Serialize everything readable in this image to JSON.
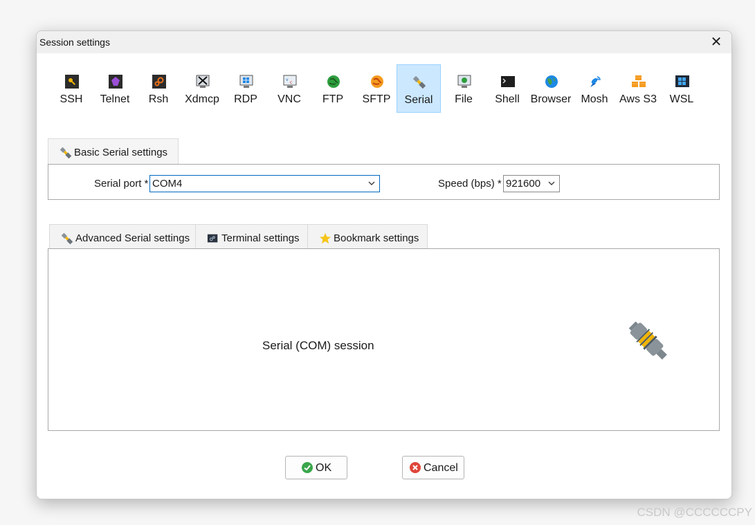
{
  "dialog": {
    "title": "Session settings",
    "close_label": "✕"
  },
  "toolbar": {
    "items": [
      {
        "label": "SSH",
        "icon": "ssh-icon"
      },
      {
        "label": "Telnet",
        "icon": "telnet-icon"
      },
      {
        "label": "Rsh",
        "icon": "rsh-icon"
      },
      {
        "label": "Xdmcp",
        "icon": "xdmcp-icon"
      },
      {
        "label": "RDP",
        "icon": "rdp-icon"
      },
      {
        "label": "VNC",
        "icon": "vnc-icon"
      },
      {
        "label": "FTP",
        "icon": "ftp-icon"
      },
      {
        "label": "SFTP",
        "icon": "sftp-icon"
      },
      {
        "label": "Serial",
        "icon": "serial-icon",
        "selected": true
      },
      {
        "label": "File",
        "icon": "file-icon"
      },
      {
        "label": "Shell",
        "icon": "shell-icon"
      },
      {
        "label": "Browser",
        "icon": "browser-icon"
      },
      {
        "label": "Mosh",
        "icon": "mosh-icon"
      },
      {
        "label": "Aws S3",
        "icon": "aws-s3-icon"
      },
      {
        "label": "WSL",
        "icon": "wsl-icon"
      }
    ]
  },
  "basic": {
    "tab_label": "Basic Serial settings",
    "serial_port_label": "Serial port *",
    "serial_port_value": "COM4",
    "speed_label": "Speed (bps) *",
    "speed_value": "921600"
  },
  "advanced_tabs": [
    {
      "label": "Advanced Serial settings",
      "icon": "plug-icon"
    },
    {
      "label": "Terminal settings",
      "icon": "terminal-icon"
    },
    {
      "label": "Bookmark settings",
      "icon": "star-icon"
    }
  ],
  "panel": {
    "caption": "Serial (COM) session"
  },
  "buttons": {
    "ok_label": "OK",
    "cancel_label": "Cancel"
  },
  "watermark": "CSDN @CCCCCCPY",
  "colors": {
    "selected_bg": "#cce8ff",
    "accent": "#0067c0",
    "ok_green": "#3aa64a",
    "cancel_red": "#e0453a"
  }
}
